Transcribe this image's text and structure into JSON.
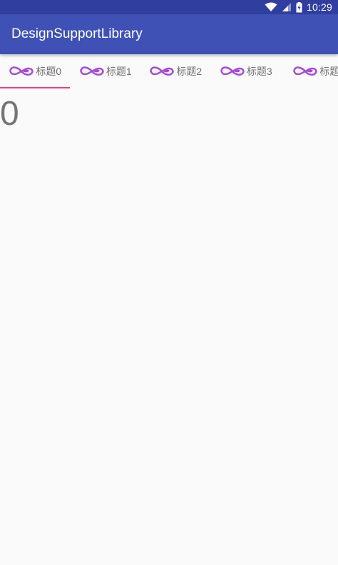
{
  "status_bar": {
    "time": "10:29",
    "icons": [
      "wifi-icon",
      "signal-icon",
      "battery-charging-icon"
    ]
  },
  "app_bar": {
    "title": "DesignSupportLibrary"
  },
  "tabs": [
    {
      "label": "标题0",
      "icon": "infinity-icon",
      "selected": true
    },
    {
      "label": "标题1",
      "icon": "infinity-icon",
      "selected": false
    },
    {
      "label": "标题2",
      "icon": "infinity-icon",
      "selected": false
    },
    {
      "label": "标题3",
      "icon": "infinity-icon",
      "selected": false
    },
    {
      "label": "标题",
      "icon": "infinity-icon",
      "selected": false
    }
  ],
  "content": {
    "page_text": "0"
  },
  "colors": {
    "status_bar": "#303f9f",
    "app_bar": "#3f51b5",
    "tab_indicator": "#ec407a",
    "icon_purple": "#a44bd6",
    "background": "#fafafa"
  }
}
